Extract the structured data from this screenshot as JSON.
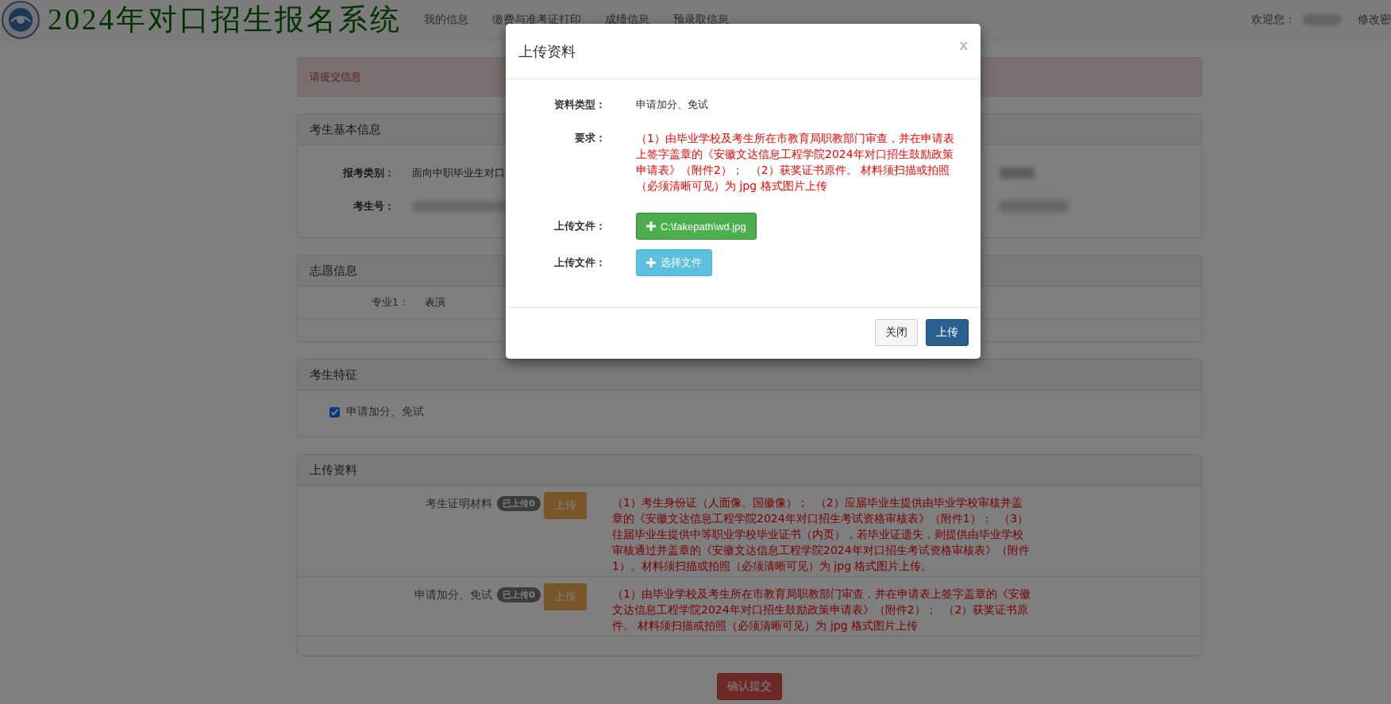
{
  "header": {
    "title": "2024年对口招生报名系统",
    "nav": [
      {
        "label": "我的信息"
      },
      {
        "label": "缴费与准考证打印"
      },
      {
        "label": "成绩信息"
      },
      {
        "label": "预录取信息"
      }
    ],
    "welcome": "欢迎您：",
    "change_password": "修改密"
  },
  "alert": "请提交信息",
  "basic_info": {
    "title": "考生基本信息",
    "fields": [
      {
        "label": "报考类别：",
        "value": "面向中职毕业生对口"
      },
      {
        "label": "考生号："
      }
    ]
  },
  "preferences": {
    "title": "志愿信息",
    "rows": [
      {
        "label": "专业1：",
        "value": "表演"
      }
    ]
  },
  "traits": {
    "title": "考生特征",
    "options": [
      {
        "label": "申请加分、免试",
        "checked": true
      }
    ]
  },
  "uploads": {
    "title": "上传资料",
    "items": [
      {
        "name": "考生证明材料",
        "badge": "已上传0",
        "button": "上传",
        "requirement": "（1）考生身份证（人面像、国徽像）；  （2）应届毕业生提供由毕业学校审核并盖章的《安徽文达信息工程学院2024年对口招生考试资格审核表》（附件1）；  （3）往届毕业生提供中等职业学校毕业证书（内页），若毕业证遗失，则提供由毕业学校审核通过并盖章的《安徽文达信息工程学院2024年对口招生考试资格审核表》（附件 1）。材料须扫描或拍照（必须清晰可见）为 jpg 格式图片上传。"
      },
      {
        "name": "申请加分、免试",
        "badge": "已上传0",
        "button": "上传",
        "requirement": "（1）由毕业学校及考生所在市教育局职教部门审查，并在申请表上签字盖章的《安徽文达信息工程学院2024年对口招生鼓励政策申请表》（附件2）；  （2）获奖证书原件。 材料须扫描或拍照（必须清晰可见）为 jpg 格式图片上传"
      }
    ]
  },
  "submit": "确认提交",
  "dialog": {
    "title": "上传资料",
    "close": "x",
    "fields": [
      {
        "kind": "text",
        "label": "资料类型：",
        "value": "申请加分、免试"
      },
      {
        "kind": "note",
        "label": "要求：",
        "value": "（1）由毕业学校及考生所在市教育局职教部门审查，并在申请表上签字盖章的《安徽文达信息工程学院2024年对口招生鼓励政策申请表》（附件2）；  （2）获奖证书原件。 材料须扫描或拍照（必须清晰可见）为 jpg 格式图片上传"
      },
      {
        "kind": "file",
        "label": "上传文件：",
        "button": "C:\\fakepath\\wd.jpg",
        "has_file": true
      },
      {
        "kind": "file",
        "label": "上传文件：",
        "button": "选择文件",
        "has_file": false
      }
    ],
    "buttons": [
      {
        "label": "关闭",
        "kind": "default"
      },
      {
        "label": "上传",
        "kind": "primary"
      }
    ]
  }
}
